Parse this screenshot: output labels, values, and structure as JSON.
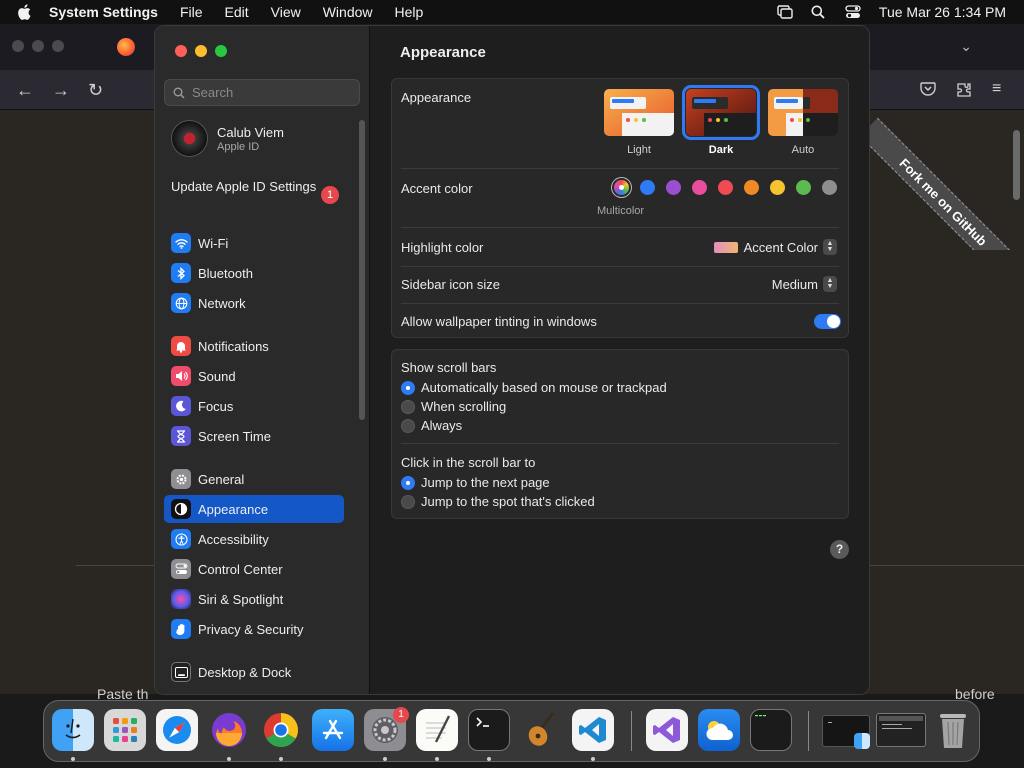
{
  "menubar": {
    "app": "System Settings",
    "items": [
      "File",
      "Edit",
      "View",
      "Window",
      "Help"
    ],
    "clock": "Tue Mar 26  1:34 PM"
  },
  "browser": {
    "bottom_text_left": "Paste th",
    "bottom_text_right": "before"
  },
  "ribbon": {
    "text": "Fork me on GitHub"
  },
  "sidebar": {
    "search_placeholder": "Search",
    "user_name": "Calub Viem",
    "user_sub": "Apple ID",
    "update_label": "Update Apple ID Settings",
    "update_badge": "1",
    "items": [
      {
        "label": "Wi-Fi",
        "icon": "wifi-icon",
        "color": "#1f7cf2"
      },
      {
        "label": "Bluetooth",
        "icon": "bluetooth-icon",
        "color": "#1f7cf2"
      },
      {
        "label": "Network",
        "icon": "globe-icon",
        "color": "#1f7cf2"
      },
      {
        "label": "Notifications",
        "icon": "bell-icon",
        "color": "#ef4b45"
      },
      {
        "label": "Sound",
        "icon": "speaker-icon",
        "color": "#ef4b6a"
      },
      {
        "label": "Focus",
        "icon": "moon-icon",
        "color": "#5b56d6"
      },
      {
        "label": "Screen Time",
        "icon": "hourglass-icon",
        "color": "#5b56d6"
      },
      {
        "label": "General",
        "icon": "gear-icon",
        "color": "#8e8e93"
      },
      {
        "label": "Appearance",
        "icon": "appearance-icon",
        "color": "#111111"
      },
      {
        "label": "Accessibility",
        "icon": "accessibility-icon",
        "color": "#1f7cf2"
      },
      {
        "label": "Control Center",
        "icon": "control-center-icon",
        "color": "#8e8e93"
      },
      {
        "label": "Siri & Spotlight",
        "icon": "siri-icon",
        "color": "#8a4fd8"
      },
      {
        "label": "Privacy & Security",
        "icon": "hand-icon",
        "color": "#1f7cf2"
      },
      {
        "label": "Desktop & Dock",
        "icon": "desktop-icon",
        "color": "#222222"
      }
    ]
  },
  "main": {
    "title": "Appearance",
    "appearance_label": "Appearance",
    "themes": [
      "Light",
      "Dark",
      "Auto"
    ],
    "accent_label": "Accent color",
    "accent_colors": [
      "#2f7bf5",
      "#9a4fd0",
      "#e84d9b",
      "#ee4b52",
      "#f08a25",
      "#f5c430",
      "#5bbb4f",
      "#8e8e8e"
    ],
    "multicolor_label": "Multicolor",
    "highlight_label": "Highlight color",
    "highlight_value": "Accent Color",
    "icon_size_label": "Sidebar icon size",
    "icon_size_value": "Medium",
    "tinting_label": "Allow wallpaper tinting in windows",
    "scroll_label": "Show scroll bars",
    "scroll_options": [
      "Automatically based on mouse or trackpad",
      "When scrolling",
      "Always"
    ],
    "click_label": "Click in the scroll bar to",
    "click_options": [
      "Jump to the next page",
      "Jump to the spot that's clicked"
    ],
    "help": "?"
  },
  "dock": {
    "settings_badge": "1"
  }
}
